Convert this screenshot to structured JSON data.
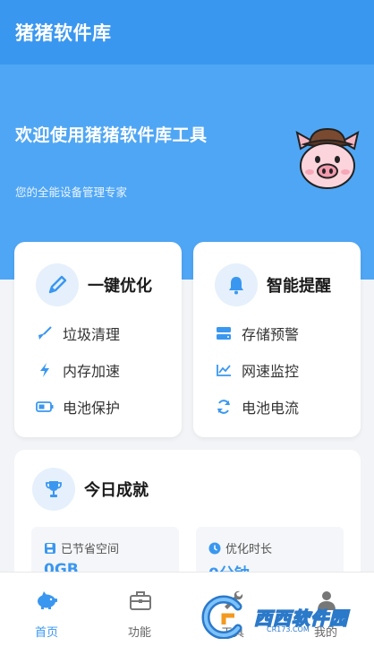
{
  "app": {
    "title": "猪猪软件库"
  },
  "hero": {
    "title": "欢迎使用猪猪软件库工具",
    "subtitle": "您的全能设备管理专家"
  },
  "cards": [
    {
      "title": "一键优化",
      "icon": "pencil-icon",
      "items": [
        {
          "label": "垃圾清理",
          "icon": "broom-icon"
        },
        {
          "label": "内存加速",
          "icon": "lightning-icon"
        },
        {
          "label": "电池保护",
          "icon": "battery-icon"
        }
      ]
    },
    {
      "title": "智能提醒",
      "icon": "bell-icon",
      "items": [
        {
          "label": "存储预警",
          "icon": "storage-icon"
        },
        {
          "label": "网速监控",
          "icon": "chart-line-icon"
        },
        {
          "label": "电池电流",
          "icon": "refresh-icon"
        }
      ]
    }
  ],
  "achievement": {
    "title": "今日成就",
    "stats": [
      {
        "label": "已节省空间",
        "value": "0GB",
        "icon": "save-icon"
      },
      {
        "label": "优化时长",
        "value": "0分钟",
        "icon": "clock-icon"
      }
    ]
  },
  "nav": {
    "items": [
      {
        "label": "首页",
        "icon": "piggy-bank-icon",
        "active": true
      },
      {
        "label": "功能",
        "icon": "toolbox-icon",
        "active": false
      },
      {
        "label": "工具",
        "icon": "wrench-icon",
        "active": false
      },
      {
        "label": "我的",
        "icon": "user-icon",
        "active": false
      }
    ]
  },
  "watermark": {
    "text": "西西软件园",
    "sub": "CR173.COM"
  },
  "colors": {
    "primary": "#3a97f0",
    "hero": "#4fa6f4",
    "icon_bg": "#e5f0fc"
  }
}
